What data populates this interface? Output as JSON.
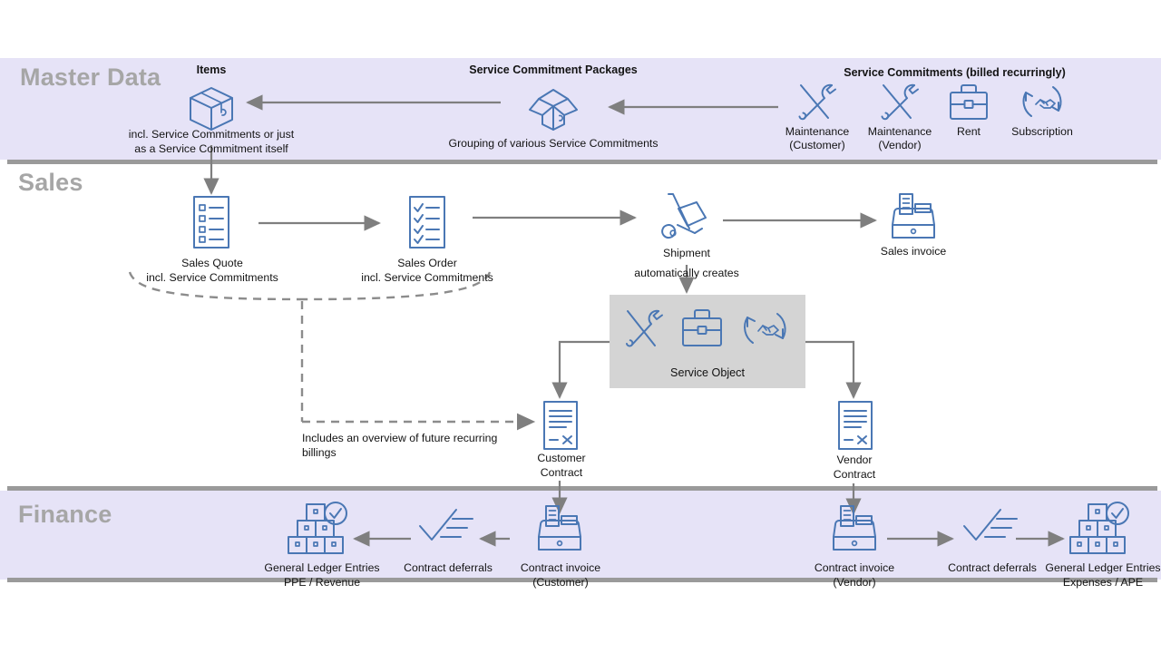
{
  "bands": [
    {
      "id": "master",
      "title": "Master Data"
    },
    {
      "id": "sales",
      "title": "Sales"
    },
    {
      "id": "finance",
      "title": "Finance"
    }
  ],
  "colors": {
    "band_background": "#e6e3f7",
    "band_divider": "#9a9a9a",
    "band_title": "#a6a6a6",
    "icon_blue": "#4a77b4",
    "arrow_gray": "#7f7f7f",
    "service_object_box": "#d4d4d4",
    "page_background": "#ffffff"
  },
  "master_data": {
    "items": {
      "title": "Items",
      "icon": "closed-box-icon",
      "caption_line1": "incl. Service Commitments or just",
      "caption_line2": "as a Service Commitment itself"
    },
    "packages": {
      "title": "Service Commitment Packages",
      "icon": "open-box-icon",
      "caption": "Grouping of various Service Commitments"
    },
    "commitments": {
      "title": "Service Commitments (billed recurringly)",
      "entries": [
        {
          "icon": "tools-icon",
          "label_line1": "Maintenance",
          "label_line2": "(Customer)"
        },
        {
          "icon": "tools-icon",
          "label_line1": "Maintenance",
          "label_line2": "(Vendor)"
        },
        {
          "icon": "briefcase-icon",
          "label_line1": "Rent",
          "label_line2": ""
        },
        {
          "icon": "subscription-cycle-icon",
          "label_line1": "Subscription",
          "label_line2": ""
        }
      ]
    }
  },
  "sales": {
    "sales_quote": {
      "icon": "checklist-document-icon",
      "label_line1": "Sales Quote",
      "label_line2": "incl. Service Commitments"
    },
    "sales_order": {
      "icon": "checked-document-icon",
      "label_line1": "Sales Order",
      "label_line2": "incl. Service Commitments"
    },
    "shipment": {
      "icon": "hand-truck-icon",
      "label": "Shipment"
    },
    "sales_invoice": {
      "icon": "cash-register-icon",
      "label": "Sales invoice"
    },
    "auto_creates_label": "automatically creates",
    "service_object": {
      "label": "Service Object",
      "icons": [
        "tools-icon",
        "briefcase-icon",
        "subscription-cycle-icon"
      ]
    },
    "customer_contract": {
      "icon": "contract-document-icon",
      "label_line1": "Customer",
      "label_line2": "Contract"
    },
    "vendor_contract": {
      "icon": "contract-document-icon",
      "label_line1": "Vendor",
      "label_line2": "Contract"
    },
    "overview_note_line1": "Includes an overview of future recurring",
    "overview_note_line2": "billings"
  },
  "finance": {
    "customer_flow": [
      {
        "icon": "cash-register-icon",
        "label_line1": "Contract invoice",
        "label_line2": "(Customer)"
      },
      {
        "icon": "checkmark-lines-icon",
        "label_line1": "Contract deferrals",
        "label_line2": ""
      },
      {
        "icon": "ledger-boxes-check-icon",
        "label_line1": "General Ledger Entries",
        "label_line2": "PPE / Revenue"
      }
    ],
    "vendor_flow": [
      {
        "icon": "cash-register-icon",
        "label_line1": "Contract invoice",
        "label_line2": "(Vendor)"
      },
      {
        "icon": "checkmark-lines-icon",
        "label_line1": "Contract deferrals",
        "label_line2": ""
      },
      {
        "icon": "ledger-boxes-check-icon",
        "label_line1": "General Ledger Entries",
        "label_line2": "Expenses / APE"
      }
    ]
  }
}
